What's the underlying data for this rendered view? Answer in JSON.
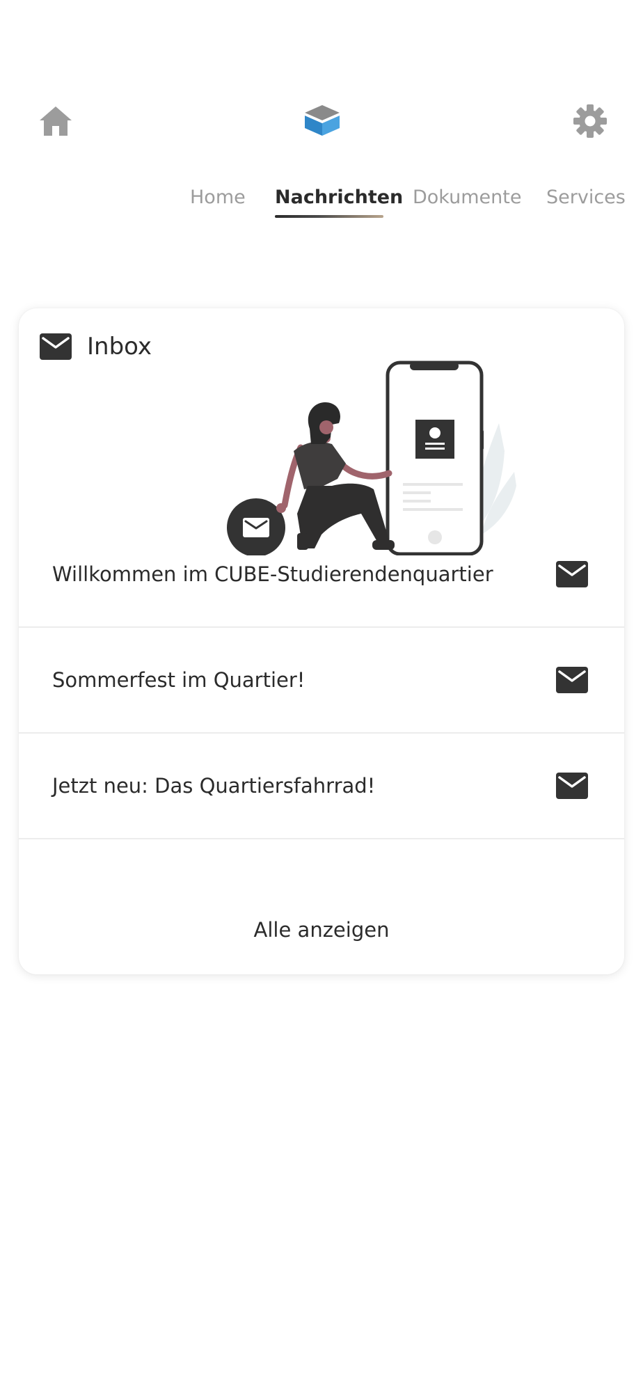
{
  "header": {
    "home_icon": "home-icon",
    "logo_icon": "cube-logo",
    "settings_icon": "gear-icon"
  },
  "tabs": [
    {
      "label": "Home",
      "active": false
    },
    {
      "label": "Nachrichten",
      "active": true
    },
    {
      "label": "Dokumente",
      "active": false
    },
    {
      "label": "Services",
      "active": false
    }
  ],
  "inbox": {
    "title": "Inbox",
    "messages": [
      {
        "title": "Willkommen im CUBE-Studierendenquartier",
        "icon": "mail-icon"
      },
      {
        "title": "Sommerfest im Quartier!",
        "icon": "mail-icon"
      },
      {
        "title": "Jetzt neu: Das Quartiersfahrrad!",
        "icon": "mail-icon"
      }
    ],
    "show_all_label": "Alle anzeigen"
  },
  "colors": {
    "accent_blue": "#3a93d6",
    "icon_gray": "#9c9c9c",
    "text_dark": "#2b2b2b",
    "illustration_skin": "#a0646c"
  }
}
